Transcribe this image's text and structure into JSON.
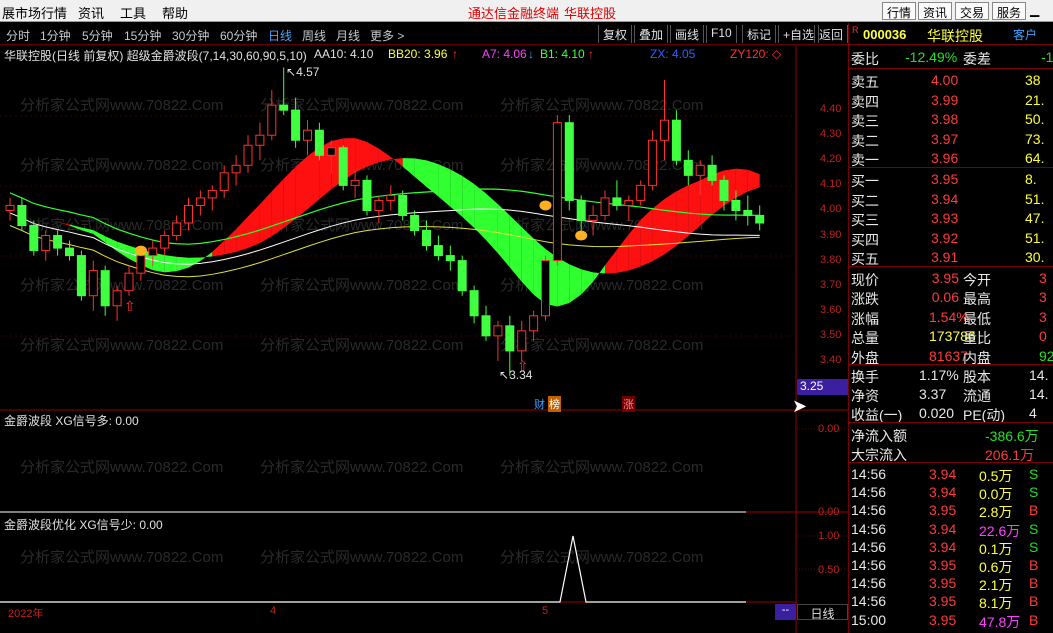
{
  "menu": {
    "left": [
      "展市场行情",
      "资讯",
      "工具",
      "帮助"
    ],
    "center": [
      "通达信金融终端",
      "华联控股"
    ],
    "right": [
      "行情",
      "资讯",
      "交易",
      "服务"
    ]
  },
  "periods": [
    "分时",
    "1分钟",
    "5分钟",
    "15分钟",
    "30分钟",
    "60分钟",
    "日线",
    "周线",
    "月线",
    "更多 >"
  ],
  "active_period": "日线",
  "toolbar": [
    "复权",
    "叠加",
    "画线",
    "F10",
    "标记",
    "+自选",
    "返回"
  ],
  "main_legend": {
    "title": "华联控股(日线 前复权) 超级金爵波段(7,14,30,60,90,5,10)",
    "aa10": "AA10: 4.10",
    "bb20": "BB20: 3.96",
    "a7": "A7: 4.06",
    "b1": "B1: 4.10",
    "zx": "ZX: 4.05",
    "zy120": "ZY120: ◇"
  },
  "price_axis": [
    "4.40",
    "4.30",
    "4.20",
    "4.10",
    "4.00",
    "3.90",
    "3.80",
    "3.70",
    "3.60",
    "3.50",
    "3.40"
  ],
  "price_tag": "3.25",
  "high_label": "4.57",
  "low_label": "3.34",
  "badges": [
    "财",
    "榜",
    "涨"
  ],
  "panel2": {
    "legend": "金爵波段  XG信号多: 0.00",
    "axis": [
      "0.00",
      "0.00"
    ]
  },
  "panel3": {
    "legend": "金爵波段优化  XG信号少: 0.00",
    "axis": [
      "1.00",
      "0.50"
    ]
  },
  "bottom": {
    "year": "2022年",
    "m4": "4",
    "m5": "5",
    "dash": "--",
    "period": "日线"
  },
  "watermark": "分析家公式网www.70822.Com",
  "stock": {
    "r": "R",
    "code": "000036",
    "name": "华联控股",
    "tag": "客户"
  },
  "weibi": {
    "label": "委比",
    "value": "-12.49%",
    "label2": "委差",
    "value2": "-1"
  },
  "asks": [
    {
      "label": "卖五",
      "price": "4.00",
      "vol": "38"
    },
    {
      "label": "卖四",
      "price": "3.99",
      "vol": "21."
    },
    {
      "label": "卖三",
      "price": "3.98",
      "vol": "50."
    },
    {
      "label": "卖二",
      "price": "3.97",
      "vol": "73."
    },
    {
      "label": "卖一",
      "price": "3.96",
      "vol": "64."
    }
  ],
  "bids": [
    {
      "label": "买一",
      "price": "3.95",
      "vol": "8."
    },
    {
      "label": "买二",
      "price": "3.94",
      "vol": "51."
    },
    {
      "label": "买三",
      "price": "3.93",
      "vol": "47."
    },
    {
      "label": "买四",
      "price": "3.92",
      "vol": "51."
    },
    {
      "label": "买五",
      "price": "3.91",
      "vol": "30."
    }
  ],
  "quote": [
    {
      "l": "现价",
      "v": "3.95",
      "l2": "今开",
      "v2": "3"
    },
    {
      "l": "涨跌",
      "v": "0.06",
      "l2": "最高",
      "v2": "3"
    },
    {
      "l": "涨幅",
      "v": "1.54%",
      "l2": "最低",
      "v2": "3"
    },
    {
      "l": "总量",
      "v": "173786",
      "l2": "量比",
      "v2": "0"
    },
    {
      "l": "外盘",
      "v": "81637",
      "l2": "内盘",
      "v2": "92"
    }
  ],
  "stats": [
    {
      "l": "换手",
      "v": "1.17%",
      "l2": "股本",
      "v2": "14."
    },
    {
      "l": "净资",
      "v": "3.37",
      "l2": "流通",
      "v2": "14."
    },
    {
      "l": "收益(一)",
      "v": "0.020",
      "l2": "PE(动)",
      "v2": "4"
    }
  ],
  "flows": [
    {
      "l": "净流入额",
      "v": "-386.6万"
    },
    {
      "l": "大宗流入",
      "v": "206.1万"
    }
  ],
  "ticks": [
    {
      "t": "14:56",
      "p": "3.94",
      "v": "0.5万",
      "s": "S"
    },
    {
      "t": "14:56",
      "p": "3.94",
      "v": "0.0万",
      "s": "S"
    },
    {
      "t": "14:56",
      "p": "3.95",
      "v": "2.8万",
      "s": "B"
    },
    {
      "t": "14:56",
      "p": "3.94",
      "v": "22.6万",
      "s": "S"
    },
    {
      "t": "14:56",
      "p": "3.94",
      "v": "0.1万",
      "s": "S"
    },
    {
      "t": "14:56",
      "p": "3.95",
      "v": "0.6万",
      "s": "B"
    },
    {
      "t": "14:56",
      "p": "3.95",
      "v": "2.1万",
      "s": "B"
    },
    {
      "t": "14:56",
      "p": "3.95",
      "v": "8.1万",
      "s": "B"
    },
    {
      "t": "15:00",
      "p": "3.95",
      "v": "47.8万",
      "s": "B"
    }
  ],
  "chart_data": {
    "type": "candlestick",
    "title": "华联控股(日线 前复权) 超级金爵波段(7,14,30,60,90,5,10)",
    "ylim": [
      3.3,
      4.6
    ],
    "candles": [
      [
        4.0,
        4.05,
        3.96,
        4.02
      ],
      [
        4.02,
        4.05,
        3.92,
        3.94
      ],
      [
        3.94,
        3.96,
        3.82,
        3.84
      ],
      [
        3.84,
        3.92,
        3.8,
        3.9
      ],
      [
        3.9,
        3.92,
        3.82,
        3.85
      ],
      [
        3.85,
        3.88,
        3.8,
        3.82
      ],
      [
        3.82,
        3.84,
        3.64,
        3.66
      ],
      [
        3.66,
        3.8,
        3.6,
        3.76
      ],
      [
        3.76,
        3.78,
        3.58,
        3.62
      ],
      [
        3.62,
        3.7,
        3.56,
        3.68
      ],
      [
        3.68,
        3.78,
        3.66,
        3.75
      ],
      [
        3.75,
        3.84,
        3.72,
        3.82
      ],
      [
        3.82,
        3.88,
        3.78,
        3.85
      ],
      [
        3.85,
        3.92,
        3.82,
        3.9
      ],
      [
        3.9,
        3.98,
        3.88,
        3.95
      ],
      [
        3.95,
        4.05,
        3.92,
        4.02
      ],
      [
        4.02,
        4.08,
        3.98,
        4.05
      ],
      [
        4.05,
        4.1,
        4.0,
        4.08
      ],
      [
        4.08,
        4.18,
        4.05,
        4.15
      ],
      [
        4.15,
        4.22,
        4.1,
        4.18
      ],
      [
        4.18,
        4.3,
        4.15,
        4.26
      ],
      [
        4.26,
        4.35,
        4.2,
        4.3
      ],
      [
        4.3,
        4.48,
        4.28,
        4.42
      ],
      [
        4.42,
        4.57,
        4.38,
        4.4
      ],
      [
        4.4,
        4.45,
        4.25,
        4.28
      ],
      [
        4.28,
        4.36,
        4.22,
        4.32
      ],
      [
        4.32,
        4.35,
        4.2,
        4.22
      ],
      [
        4.22,
        4.28,
        4.15,
        4.25
      ],
      [
        4.25,
        4.26,
        4.08,
        4.1
      ],
      [
        4.1,
        4.16,
        4.05,
        4.12
      ],
      [
        4.12,
        4.14,
        3.98,
        4.0
      ],
      [
        4.0,
        4.06,
        3.95,
        4.04
      ],
      [
        4.04,
        4.1,
        4.0,
        4.06
      ],
      [
        4.06,
        4.08,
        3.96,
        3.98
      ],
      [
        3.98,
        4.0,
        3.9,
        3.92
      ],
      [
        3.92,
        3.96,
        3.84,
        3.86
      ],
      [
        3.86,
        3.9,
        3.8,
        3.82
      ],
      [
        3.82,
        3.86,
        3.76,
        3.8
      ],
      [
        3.8,
        3.82,
        3.66,
        3.68
      ],
      [
        3.68,
        3.7,
        3.55,
        3.58
      ],
      [
        3.58,
        3.62,
        3.48,
        3.5
      ],
      [
        3.5,
        3.56,
        3.4,
        3.54
      ],
      [
        3.54,
        3.58,
        3.34,
        3.44
      ],
      [
        3.44,
        3.56,
        3.4,
        3.52
      ],
      [
        3.52,
        3.6,
        3.48,
        3.58
      ],
      [
        3.58,
        3.82,
        3.56,
        3.8
      ],
      [
        3.8,
        4.38,
        3.78,
        4.35
      ],
      [
        4.35,
        4.38,
        4.0,
        4.04
      ],
      [
        4.04,
        4.06,
        3.92,
        3.96
      ],
      [
        3.96,
        4.02,
        3.9,
        3.98
      ],
      [
        3.98,
        4.08,
        3.96,
        4.05
      ],
      [
        4.05,
        4.12,
        4.0,
        4.02
      ],
      [
        4.02,
        4.06,
        3.96,
        4.04
      ],
      [
        4.04,
        4.12,
        4.02,
        4.1
      ],
      [
        4.1,
        4.32,
        4.08,
        4.28
      ],
      [
        4.28,
        4.52,
        4.2,
        4.36
      ],
      [
        4.36,
        4.4,
        4.18,
        4.2
      ],
      [
        4.2,
        4.24,
        4.1,
        4.14
      ],
      [
        4.14,
        4.2,
        4.06,
        4.18
      ],
      [
        4.18,
        4.22,
        4.1,
        4.12
      ],
      [
        4.12,
        4.14,
        4.0,
        4.04
      ],
      [
        4.04,
        4.08,
        3.96,
        4.0
      ],
      [
        4.0,
        4.06,
        3.94,
        3.98
      ],
      [
        3.98,
        4.02,
        3.92,
        3.95
      ]
    ]
  }
}
